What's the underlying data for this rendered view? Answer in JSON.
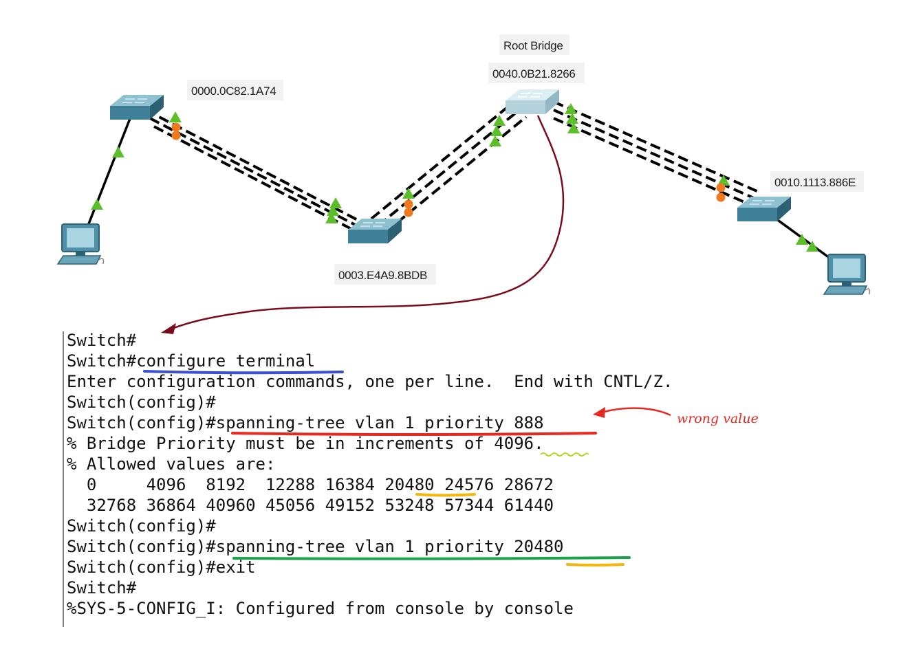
{
  "diagram": {
    "root_bridge_label": "Root Bridge",
    "switches": [
      {
        "id": "sw-left",
        "mac": "0000.0C82.1A74",
        "color": "#4f8fa7"
      },
      {
        "id": "sw-middle",
        "mac": "0003.E4A9.8BDB",
        "color": "#4f8fa7"
      },
      {
        "id": "sw-root",
        "mac": "0040.0B21.8266",
        "color": "#b9d6de"
      },
      {
        "id": "sw-right",
        "mac": "0010.1113.886E",
        "color": "#4f8fa7"
      }
    ],
    "pcs": [
      "pc-left",
      "pc-right"
    ],
    "port_colors": {
      "forwarding": "#5cbf2a",
      "blocking": "#f0781e"
    },
    "link_color": "#000000"
  },
  "annotation": {
    "wrong_value": "wrong value",
    "colors": {
      "blue": "#3a4fd1",
      "red": "#e8281f",
      "green": "#1aa34a",
      "orange": "#f5b50f",
      "lime": "#b8d62a",
      "arrow": "#7a0c1e"
    }
  },
  "console": {
    "lines": [
      "Switch#",
      "Switch#configure terminal",
      "Enter configuration commands, one per line.  End with CNTL/Z.",
      "Switch(config)#",
      "Switch(config)#spanning-tree vlan 1 priority 888",
      "% Bridge Priority must be in increments of 4096.",
      "% Allowed values are:",
      "  0     4096  8192  12288 16384 20480 24576 28672",
      "  32768 36864 40960 45056 49152 53248 57344 61440",
      "Switch(config)#",
      "Switch(config)#spanning-tree vlan 1 priority 20480",
      "Switch(config)#exit",
      "Switch#",
      "%SYS-5-CONFIG_I: Configured from console by console"
    ]
  }
}
